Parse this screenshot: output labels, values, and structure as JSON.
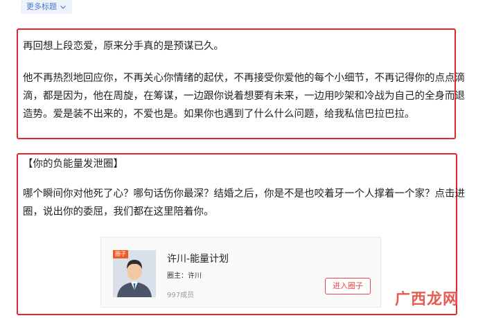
{
  "header": {
    "more_tags_label": "更多标题"
  },
  "article": {
    "para1": "再回想上段恋爱，原来分手真的是预谋已久。",
    "para2": "他不再热烈地回应你，不再关心你情绪的起伏，不再接受你爱他的每个小细节，不再记得你的点点滴滴，都是因为，他在周旋，在筹谋，一边跟你说着想要有未来，一边用吵架和冷战为自己的全身而退造势。爱是装不出来的，不爱也是。如果你也遇到了什么什么问题，给我私信巴拉巴拉。",
    "para3": "【你的负能量发泄圈】",
    "para4": "哪个瞬间你对他死了心？哪句话伤你最深？结婚之后，你是不是也咬着牙一个人撑着一个家？点击进圈，说出你的委屈，我们都在这里陪着你。"
  },
  "circle_card": {
    "badge": "圈子",
    "name": "许川-能量计划",
    "owner": "圈主：许川",
    "members": "997成员",
    "join_label": "进入圈子"
  },
  "watermark": {
    "text": "广西龙网"
  },
  "colors": {
    "highlight_border": "#e3262b",
    "join_red": "#e54848",
    "tag_blue": "#4a79c8"
  }
}
